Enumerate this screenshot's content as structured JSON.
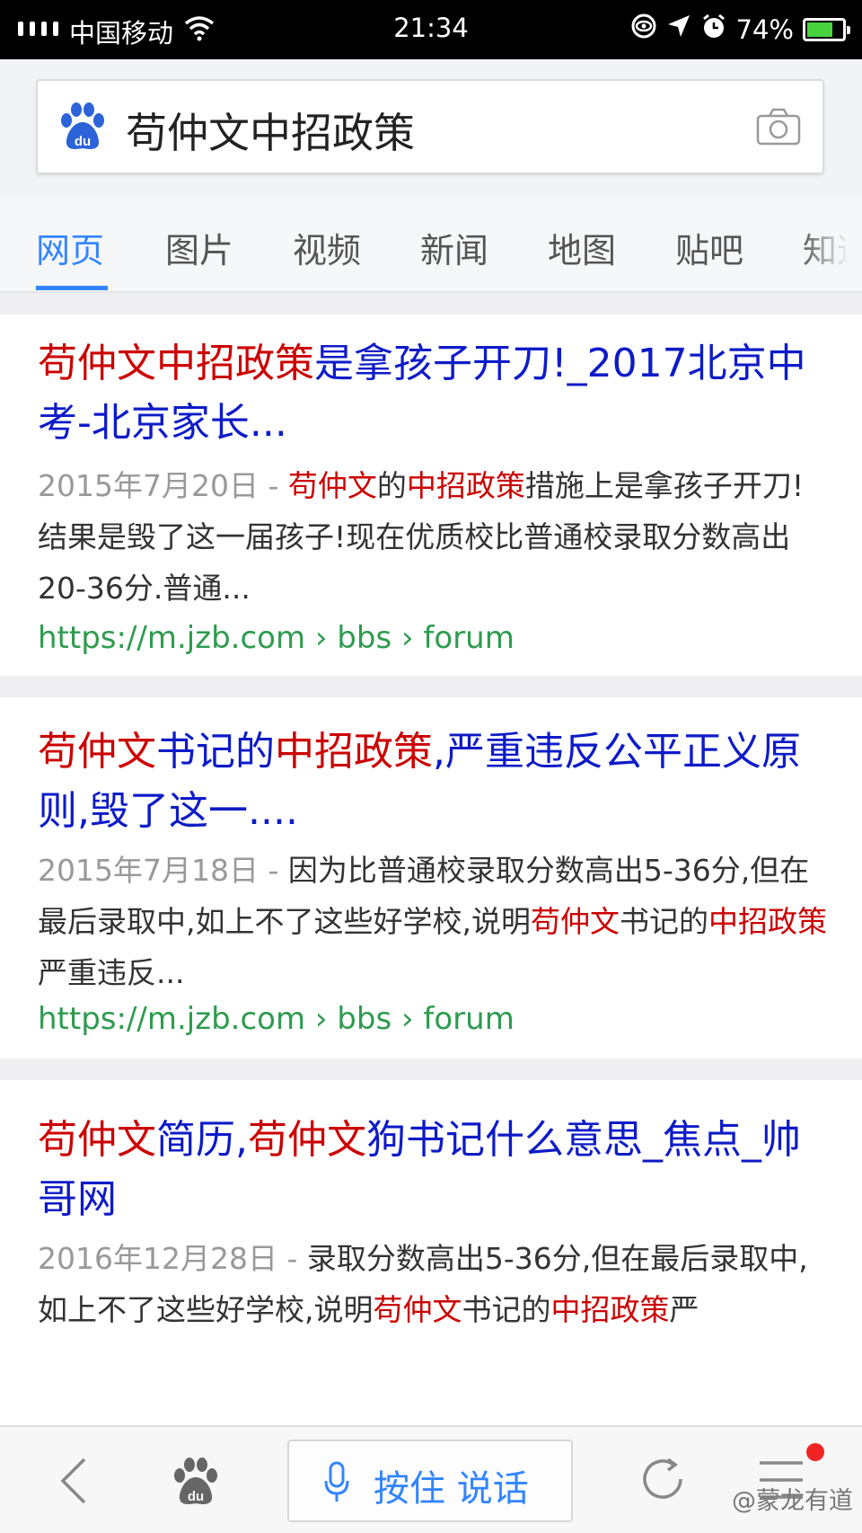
{
  "status_bar": {
    "carrier": "中国移动",
    "time": "21:34",
    "battery": "74%",
    "battery_level": 0.74
  },
  "search": {
    "query": "苟仲文中招政策"
  },
  "tabs": [
    "网页",
    "图片",
    "视频",
    "新闻",
    "地图",
    "贴吧",
    "知道"
  ],
  "active_tab": "网页",
  "results": [
    {
      "title_hl": "苟仲文中招政策",
      "title_rest": "是拿孩子开刀!_2017北京中考-北京家长...",
      "date": "2015年7月20日 - ",
      "snippet": [
        {
          "t": "苟仲文",
          "hl": true
        },
        {
          "t": "的",
          "hl": false
        },
        {
          "t": "中招政策",
          "hl": true
        },
        {
          "t": "措施上是拿孩子开刀!结果是毁了这一届孩子!现在优质校比普通校录取分数高出20-36分.普通...",
          "hl": false
        }
      ],
      "url": "https://m.jzb.com › bbs › forum"
    },
    {
      "title_parts": [
        {
          "t": "苟仲文",
          "hl": true
        },
        {
          "t": "书记的",
          "hl": false
        },
        {
          "t": "中招政策",
          "hl": true
        },
        {
          "t": ",严重违反公平正义原则,毁了这一....",
          "hl": false
        }
      ],
      "date": "2015年7月18日 - ",
      "snippet": [
        {
          "t": "因为比普通校录取分数高出5-36分,但在最后录取中,如上不了这些好学校,说明",
          "hl": false
        },
        {
          "t": "苟仲文",
          "hl": true
        },
        {
          "t": "书记的",
          "hl": false
        },
        {
          "t": "中招政策",
          "hl": true
        },
        {
          "t": "严重违反...",
          "hl": false
        }
      ],
      "url": "https://m.jzb.com › bbs › forum"
    },
    {
      "title_parts": [
        {
          "t": "苟仲文",
          "hl": true
        },
        {
          "t": "简历,",
          "hl": false
        },
        {
          "t": "苟仲文",
          "hl": true
        },
        {
          "t": "狗书记什么意思_焦点_帅哥网",
          "hl": false
        }
      ],
      "date": "2016年12月28日 - ",
      "snippet": [
        {
          "t": "录取分数高出5-36分,但在最后录取中,如上不了这些好学校,说明",
          "hl": false
        },
        {
          "t": "苟仲文",
          "hl": true
        },
        {
          "t": "书记的",
          "hl": false
        },
        {
          "t": "中招政策",
          "hl": true
        },
        {
          "t": "严",
          "hl": false
        }
      ]
    }
  ],
  "bottom_bar": {
    "voice_label": "按住 说话",
    "watermark": "@蒙龙有道"
  },
  "colors": {
    "accent": "#3385ff",
    "title_blue": "#0e1bc8",
    "highlight_red": "#cc0000",
    "url_green": "#2e9b4f",
    "notification_red": "#f02424"
  }
}
